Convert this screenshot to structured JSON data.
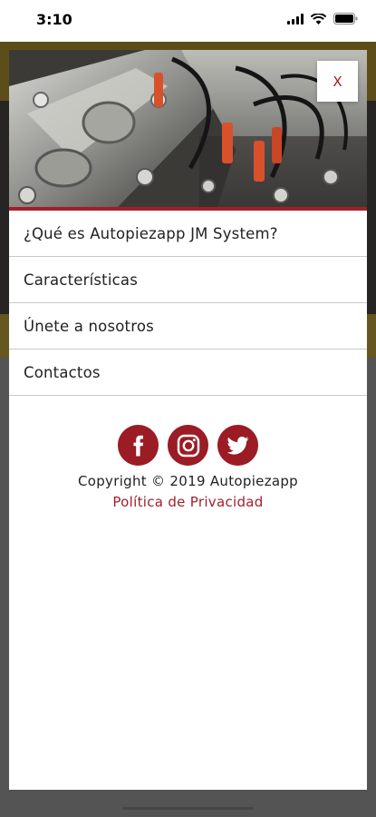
{
  "status_bar": {
    "time": "3:10"
  },
  "close_label": "X",
  "menu": {
    "items": [
      {
        "label": "¿Qué es Autopiezapp JM System?"
      },
      {
        "label": "Características"
      },
      {
        "label": "Únete a nosotros"
      },
      {
        "label": "Contactos"
      }
    ]
  },
  "social": {
    "icons": [
      "facebook-icon",
      "instagram-icon",
      "twitter-icon"
    ]
  },
  "footer": {
    "copyright": "Copyright © 2019 Autopiezapp",
    "privacy_link": "Política de Privacidad"
  },
  "colors": {
    "brand_red": "#9b1c25",
    "accent_gold": "#66561f"
  }
}
